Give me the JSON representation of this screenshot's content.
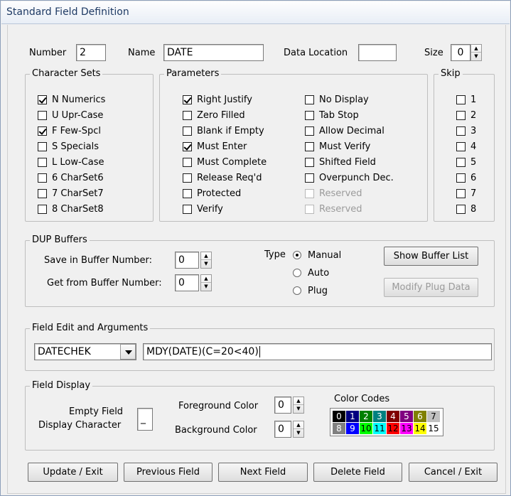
{
  "window": {
    "title": "Standard Field Definition"
  },
  "top": {
    "number_label": "Number",
    "number_value": "2",
    "name_label": "Name",
    "name_value": "DATE",
    "data_location_label": "Data Location",
    "data_location_value": "",
    "size_label": "Size",
    "size_value": "0"
  },
  "character_sets": {
    "legend": "Character Sets",
    "items": [
      {
        "label": "N  Numerics",
        "checked": true
      },
      {
        "label": "U  Upr-Case",
        "checked": false
      },
      {
        "label": "F  Few-Spcl",
        "checked": true
      },
      {
        "label": "S  Specials",
        "checked": false
      },
      {
        "label": "L  Low-Case",
        "checked": false
      },
      {
        "label": "6  CharSet6",
        "checked": false
      },
      {
        "label": "7  CharSet7",
        "checked": false
      },
      {
        "label": "8  CharSet8",
        "checked": false
      }
    ]
  },
  "parameters": {
    "legend": "Parameters",
    "col1": [
      {
        "label": "Right Justify",
        "checked": true
      },
      {
        "label": "Zero Filled",
        "checked": false
      },
      {
        "label": "Blank if Empty",
        "checked": false
      },
      {
        "label": "Must Enter",
        "checked": true
      },
      {
        "label": "Must Complete",
        "checked": false
      },
      {
        "label": "Release Req'd",
        "checked": false
      },
      {
        "label": "Protected",
        "checked": false
      },
      {
        "label": "Verify",
        "checked": false
      }
    ],
    "col2": [
      {
        "label": "No Display",
        "checked": false
      },
      {
        "label": "Tab Stop",
        "checked": false
      },
      {
        "label": "Allow Decimal",
        "checked": false
      },
      {
        "label": "Must Verify",
        "checked": false
      },
      {
        "label": "Shifted Field",
        "checked": false
      },
      {
        "label": "Overpunch Dec.",
        "checked": false
      },
      {
        "label": "Reserved",
        "checked": false,
        "disabled": true
      },
      {
        "label": "Reserved",
        "checked": false,
        "disabled": true
      }
    ]
  },
  "skip": {
    "legend": "Skip",
    "items": [
      "1",
      "2",
      "3",
      "4",
      "5",
      "6",
      "7",
      "8"
    ]
  },
  "dup": {
    "legend": "DUP Buffers",
    "save_label": "Save in Buffer Number:",
    "save_value": "0",
    "get_label": "Get from Buffer Number:",
    "get_value": "0",
    "type_label": "Type",
    "types": [
      {
        "label": "Manual",
        "selected": true
      },
      {
        "label": "Auto",
        "selected": false
      },
      {
        "label": "Plug",
        "selected": false
      }
    ],
    "show_buffer_list": "Show Buffer List",
    "modify_plug_data": "Modify Plug Data"
  },
  "edit": {
    "legend": "Field Edit and Arguments",
    "routine": "DATECHEK",
    "arguments": "MDY(DATE)(C=20<40)"
  },
  "display": {
    "legend": "Field Display",
    "empty_label_1": "Empty Field",
    "empty_label_2": "Display Character",
    "empty_value": "_",
    "fg_label": "Foreground Color",
    "fg_value": "0",
    "bg_label": "Background Color",
    "bg_value": "0",
    "codes_label": "Color Codes",
    "codes_row1": [
      {
        "n": "0",
        "bg": "#000000",
        "fg": "#ffffff"
      },
      {
        "n": "1",
        "bg": "#000080",
        "fg": "#ffffff"
      },
      {
        "n": "2",
        "bg": "#008000",
        "fg": "#ffffff"
      },
      {
        "n": "3",
        "bg": "#008080",
        "fg": "#ffffff"
      },
      {
        "n": "4",
        "bg": "#800000",
        "fg": "#ffffff"
      },
      {
        "n": "5",
        "bg": "#800080",
        "fg": "#ffffff"
      },
      {
        "n": "6",
        "bg": "#808000",
        "fg": "#ffffff"
      },
      {
        "n": "7",
        "bg": "#c0c0c0",
        "fg": "#000000"
      }
    ],
    "codes_row2": [
      {
        "n": "8",
        "bg": "#808080",
        "fg": "#ffffff"
      },
      {
        "n": "9",
        "bg": "#0000ff",
        "fg": "#ffffff"
      },
      {
        "n": "10",
        "bg": "#00ff00",
        "fg": "#000000"
      },
      {
        "n": "11",
        "bg": "#00ffff",
        "fg": "#000000"
      },
      {
        "n": "12",
        "bg": "#ff0000",
        "fg": "#000000"
      },
      {
        "n": "13",
        "bg": "#ff00ff",
        "fg": "#000000"
      },
      {
        "n": "14",
        "bg": "#ffff00",
        "fg": "#000000"
      },
      {
        "n": "15",
        "bg": "#ffffff",
        "fg": "#000000"
      }
    ]
  },
  "buttons": {
    "update_exit": "Update / Exit",
    "previous_field": "Previous Field",
    "next_field": "Next Field",
    "delete_field": "Delete Field",
    "cancel_exit": "Cancel / Exit"
  }
}
